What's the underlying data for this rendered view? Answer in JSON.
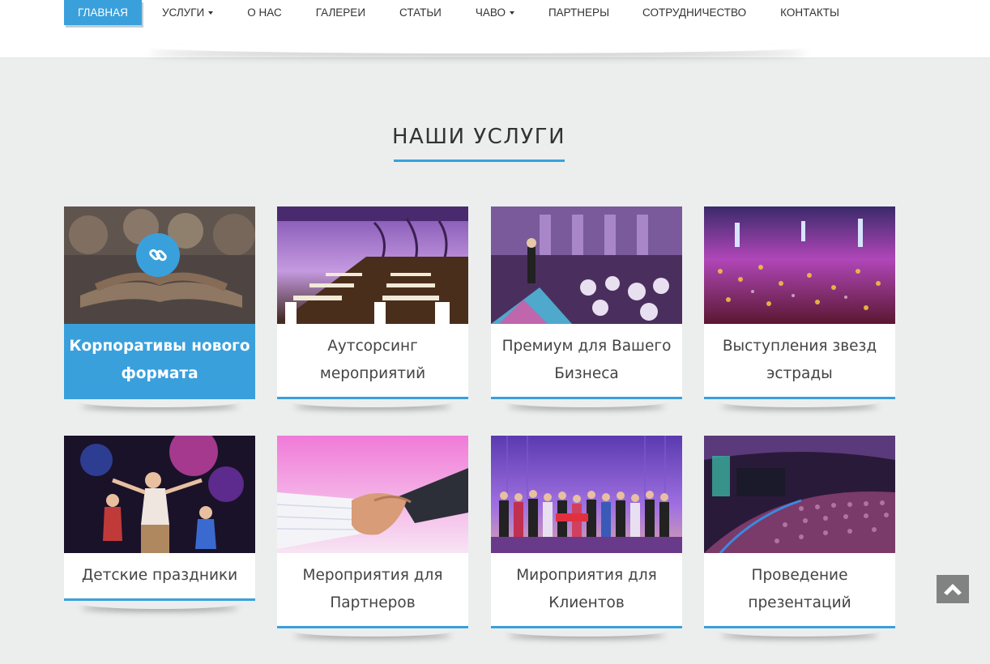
{
  "nav": {
    "items": [
      {
        "label": "ГЛАВНАЯ",
        "dropdown": false,
        "active": true
      },
      {
        "label": "УСЛУГИ",
        "dropdown": true,
        "active": false
      },
      {
        "label": "О НАС",
        "dropdown": false,
        "active": false
      },
      {
        "label": "ГАЛЕРЕИ",
        "dropdown": false,
        "active": false
      },
      {
        "label": "СТАТЬИ",
        "dropdown": false,
        "active": false
      },
      {
        "label": "ЧАВО",
        "dropdown": true,
        "active": false
      },
      {
        "label": "ПАРТНЕРЫ",
        "dropdown": false,
        "active": false
      },
      {
        "label": "СОТРУДНИЧЕСТВО",
        "dropdown": false,
        "active": false
      },
      {
        "label": "КОНТАКТЫ",
        "dropdown": false,
        "active": false
      }
    ]
  },
  "section": {
    "title": "НАШИ УСЛУГИ"
  },
  "services": [
    {
      "title": "Корпоративы нового формата",
      "image": "team-hands-photo",
      "active": true
    },
    {
      "title": "Аутсорсинг мероприятий",
      "image": "banquet-hall-photo",
      "active": false
    },
    {
      "title": "Премиум для Вашего Бизнеса",
      "image": "gala-dinner-photo",
      "active": false
    },
    {
      "title": "Выступления звезд эстрады",
      "image": "concert-crowd-photo",
      "active": false
    },
    {
      "title": "Детские праздники",
      "image": "kids-party-photo",
      "active": false
    },
    {
      "title": "Мероприятия для Партнеров",
      "image": "handshake-photo",
      "active": false
    },
    {
      "title": "Мироприятия для Клиентов",
      "image": "award-stage-photo",
      "active": false
    },
    {
      "title": "Проведение презентаций",
      "image": "conference-hall-photo",
      "active": false
    }
  ],
  "icons": {
    "link": "link-icon",
    "scroll_top": "arrow-up-icon"
  },
  "colors": {
    "accent": "#3aa0dc",
    "background": "#eceeee"
  }
}
